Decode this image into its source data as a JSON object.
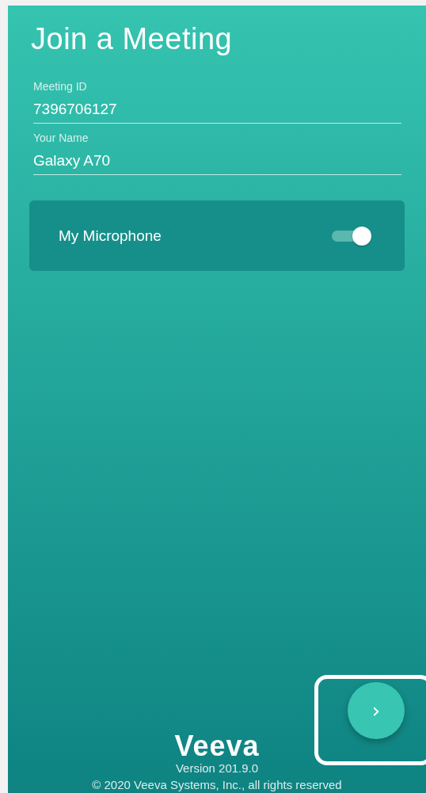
{
  "title": "Join a Meeting",
  "fields": [
    {
      "label": "Meeting ID",
      "value": "7396706127"
    },
    {
      "label": "Your Name",
      "value": "Galaxy A70"
    }
  ],
  "microphone": {
    "label": "My Microphone",
    "on": true
  },
  "next_button": {
    "icon": "›",
    "highlighted": true
  },
  "footer": {
    "logo": "Veeva",
    "version": "Version 201.9.0",
    "copyright": "© 2020 Veeva Systems, Inc., all rights reserved"
  }
}
